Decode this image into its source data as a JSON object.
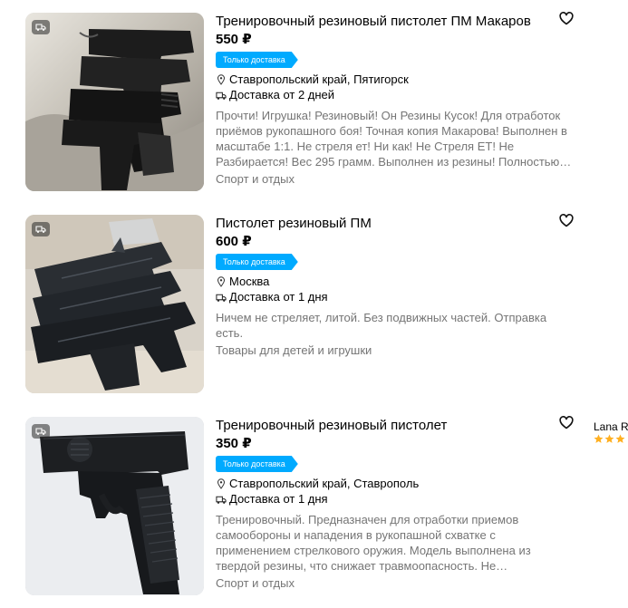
{
  "listings": [
    {
      "title": "Тренировочный резиновый пистолет ПМ Макаров",
      "price": "550 ₽",
      "badge": "Только доставка",
      "location": "Ставропольский край, Пятигорск",
      "delivery": "Доставка от 2 дней",
      "description": "Прочти! Игрушка! Резиновый! Он Резины Кусок! Для отработок приёмов рукопашного боя! Точная копия Макарова! Выполнен в масштабе 1:1. Не стреля ет! Ни как! Не Стреля ЕТ! Не Разбирается! Вес 295 грамм. Выполнен из резины! Полностью…",
      "category": "Спорт и отдых"
    },
    {
      "title": "Пистолет резиновый ПМ",
      "price": "600 ₽",
      "badge": "Только доставка",
      "location": "Москва",
      "delivery": "Доставка от 1 дня",
      "description": "Ничем не стреляет, литой. Без подвижных частей. Отправка есть.",
      "category": "Товары для детей и игрушки"
    },
    {
      "title": "Тренировочный резиновый пистолет",
      "price": "350 ₽",
      "badge": "Только доставка",
      "location": "Ставропольский край, Ставрополь",
      "delivery": "Доставка от 1 дня",
      "description": "Тренировочный. Предназначен для отработки приемов самообороны и нападения в рукопашной схватке с применением стрелкового оружия. Модель выполнена из твердой резины, что снижает травмоопасность. Не…",
      "category": "Спорт и отдых",
      "seller": {
        "name": "Lana R",
        "rating_stars": 3
      }
    }
  ],
  "colors": {
    "accent": "#00aaff",
    "muted_text": "#757575",
    "star": "#ffb021"
  },
  "icons": {
    "favorite": "heart-outline-icon",
    "location": "pin-icon",
    "delivery": "truck-icon"
  }
}
